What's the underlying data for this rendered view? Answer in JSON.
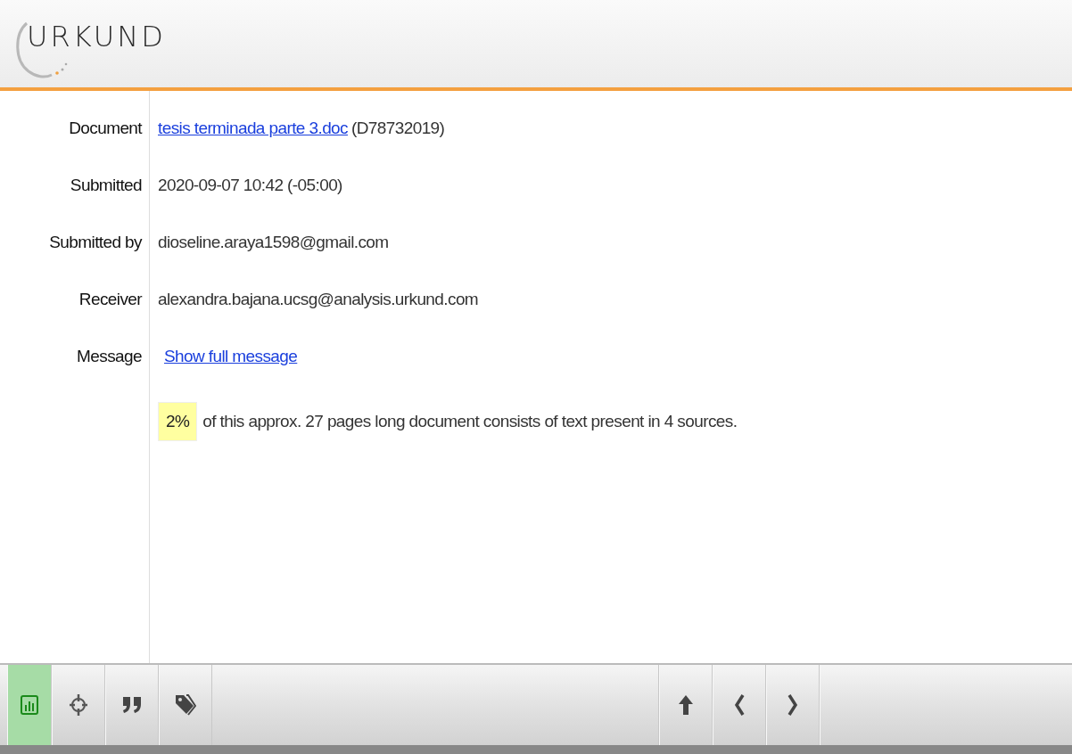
{
  "header": {
    "logo": "URKUND"
  },
  "details": [
    {
      "label": "Document",
      "kind": "link",
      "link": "tesis terminada parte 3.doc",
      "text": "(D78732019)"
    },
    {
      "label": "Submitted",
      "kind": "text",
      "text": "2020-09-07 10:42 (-05:00)"
    },
    {
      "label": "Submitted by",
      "kind": "text",
      "text": "dioseline.araya1598@gmail.com"
    },
    {
      "label": "Receiver",
      "kind": "text",
      "text": "alexandra.bajana.ucsg@analysis.urkund.com"
    },
    {
      "label": "Message",
      "kind": "link",
      "link": "Show full message"
    }
  ],
  "summary": {
    "percent": "2%",
    "text": "of this approx. 27 pages long document consists of text present in 4 sources."
  },
  "toolbar": {
    "tools": [
      {
        "kind": "chart",
        "selected": true
      },
      {
        "kind": "target",
        "selected": false
      },
      {
        "kind": "quote",
        "selected": false
      },
      {
        "kind": "tags",
        "selected": false
      }
    ],
    "nav": [
      {
        "kind": "up"
      },
      {
        "kind": "prev"
      },
      {
        "kind": "next"
      }
    ]
  }
}
